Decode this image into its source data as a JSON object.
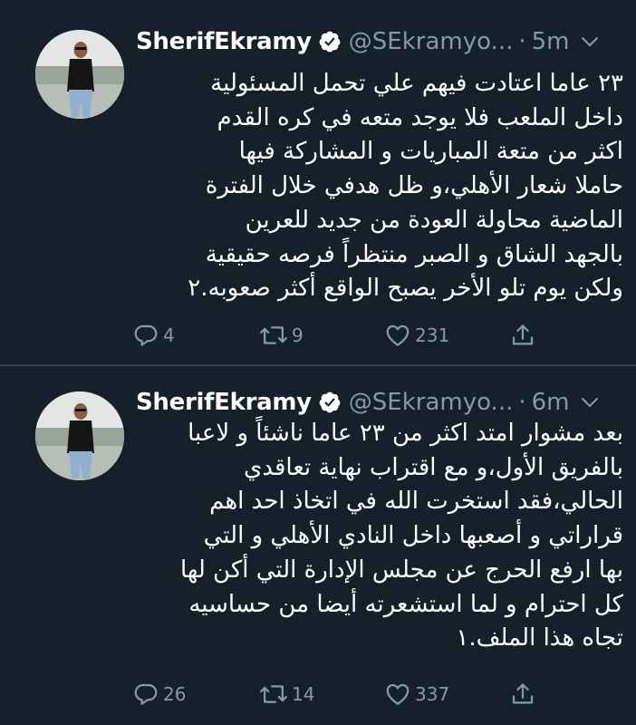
{
  "colors": {
    "background": "#15202b",
    "text": "#ffffff",
    "secondary_text": "#8899a6",
    "divider": "#38444d",
    "verified_badge": "#ffffff"
  },
  "tweets": [
    {
      "display_name": "SherifEkramy",
      "handle": "@SEkramyo...",
      "separator": "·",
      "time": "5m",
      "verified": true,
      "lines": [
        "٢٣ عاما اعتادت فيهم علي تحمل المسئولية",
        "داخل الملعب فلا يوجد متعه في كره القدم",
        "اكثر من متعة المباريات و المشاركة فيها",
        "حاملا شعار الأهلي،و ظل هدفي خلال الفترة",
        "الماضية محاولة العودة من جديد للعرين",
        "بالجهد الشاق و الصبر منتظراً فرصه حقيقية",
        "ولكن يوم تلو الأخر يصبح الواقع أكثر صعوبه.٢"
      ],
      "replies": "4",
      "retweets": "9",
      "likes": "231"
    },
    {
      "display_name": "SherifEkramy",
      "handle": "@SEkramyo...",
      "separator": "·",
      "time": "6m",
      "verified": true,
      "lines": [
        "بعد مشوار امتد اكثر من ٢٣ عاما ناشئاً و لاعبا",
        "بالفريق الأول،و مع اقتراب نهاية تعاقدي",
        "الحالي،فقد استخرت الله في اتخاذ احد اهم",
        "قراراتي و أصعبها داخل النادي الأهلي و التي",
        "بها ارفع الحرج عن مجلس الإدارة التي أكن لها",
        "كل احترام و لما استشعرته أيضا من حساسيه",
        "تجاه هذا الملف.١"
      ],
      "replies": "26",
      "retweets": "14",
      "likes": "337"
    }
  ]
}
